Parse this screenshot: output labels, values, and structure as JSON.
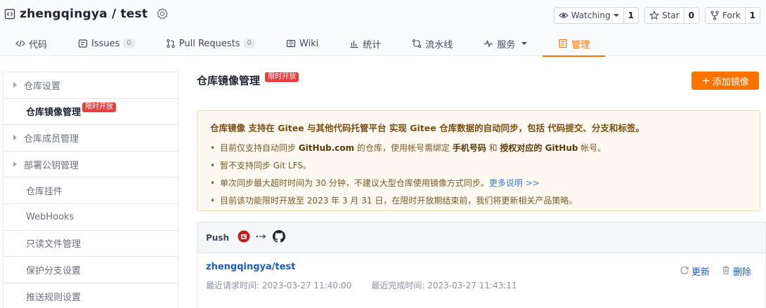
{
  "header": {
    "repo_name": "zhengqingya / test",
    "watch": {
      "label": "Watching",
      "count": "1"
    },
    "star": {
      "label": "Star",
      "count": "0"
    },
    "fork": {
      "label": "Fork",
      "count": "1"
    }
  },
  "tabs": [
    {
      "label": "代码",
      "icon": "code-icon"
    },
    {
      "label": "Issues",
      "count": "0",
      "icon": "issues-icon"
    },
    {
      "label": "Pull Requests",
      "count": "0",
      "icon": "pull-request-icon"
    },
    {
      "label": "Wiki",
      "icon": "wiki-icon"
    },
    {
      "label": "统计",
      "icon": "stats-icon"
    },
    {
      "label": "流水线",
      "icon": "pipeline-icon"
    },
    {
      "label": "服务",
      "icon": "service-icon"
    },
    {
      "label": "管理",
      "icon": "manage-icon"
    }
  ],
  "sidebar": {
    "items": [
      {
        "label": "仓库设置"
      },
      {
        "label": "仓库镜像管理",
        "tag": "限时开放"
      },
      {
        "label": "仓库成员管理"
      },
      {
        "label": "部署公钥管理"
      },
      {
        "label": "仓库挂件"
      },
      {
        "label": "WebHooks"
      },
      {
        "label": "只读文件管理"
      },
      {
        "label": "保护分支设置"
      },
      {
        "label": "推送规则设置"
      }
    ]
  },
  "main": {
    "title": "仓库镜像管理",
    "title_tag": "限时开放",
    "add_button": "添加镜像",
    "notice": {
      "lead": "仓库镜像 支持在 Gitee 与其他代码托管平台 实现 Gitee 仓库数据的自动同步，包括 代码提交、分支和标签。",
      "line1_a": "目前仅支持自动同步 ",
      "line1_b": "GitHub.com",
      "line1_c": " 的仓库，使用帐号需绑定 ",
      "line1_d": "手机号码",
      "line1_e": " 和 ",
      "line1_f": "授权对应的 GitHub",
      "line1_g": " 帐号。",
      "line2": "暂不支持同步 Git LFS。",
      "line3_a": "单次同步最大超时时间为 30 分钟，不建议大型仓库使用镜像方式同步。",
      "line3_link": "更多说明 >>",
      "line4": "目前该功能限时开放至 2023 年 3 月 31 日，在限时开放期结束前，我们将更新相关产品策略。"
    },
    "mirror": {
      "direction": "Push",
      "repo": "zhengqingya/test",
      "last_request_label": "最近请求时间:",
      "last_request": "2023-03-27 11:40:00",
      "last_done_label": "最近完成时间:",
      "last_done": "2023-03-27 11:43:11",
      "update_label": "更新",
      "delete_label": "删除"
    }
  },
  "colors": {
    "accent": "#fe7300",
    "tag_red": "#e73e3e",
    "link": "#1b5ebd"
  }
}
